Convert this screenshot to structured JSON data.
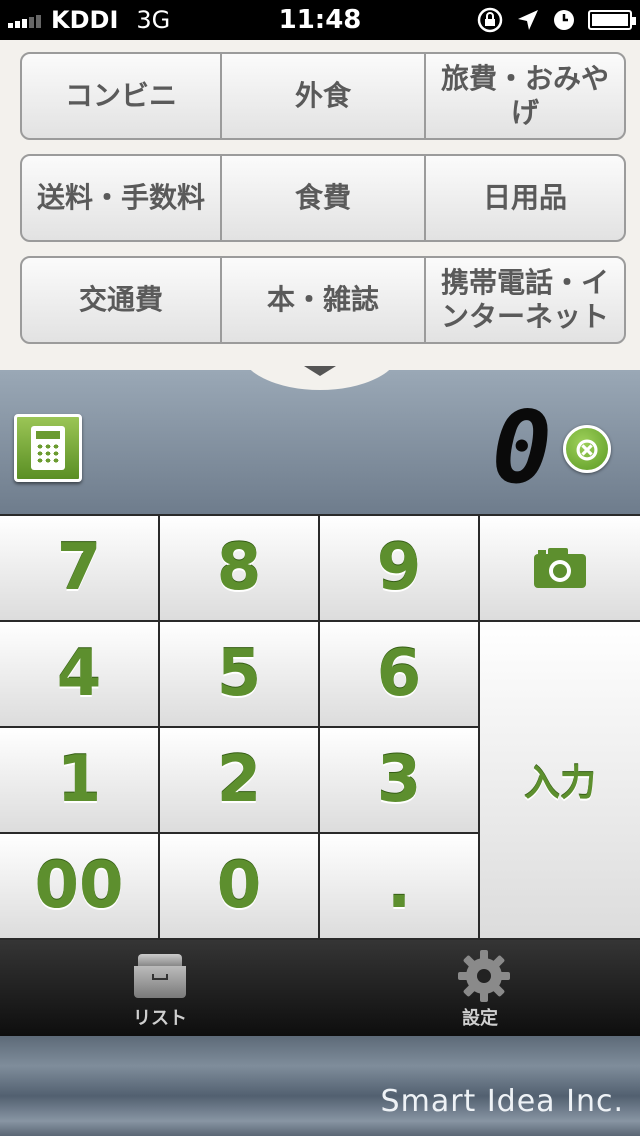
{
  "status_bar": {
    "carrier": "KDDI",
    "network": "3G",
    "time": "11:48",
    "icons": [
      "rotation-lock-icon",
      "location-icon",
      "alarm-icon",
      "battery-icon"
    ]
  },
  "categories": [
    [
      "コンビニ",
      "外食",
      "旅費・おみやげ"
    ],
    [
      "送料・手数料",
      "食費",
      "日用品"
    ],
    [
      "交通費",
      "本・雑誌",
      "携帯電話・インターネット"
    ]
  ],
  "display": {
    "amount": "0",
    "clear_label": "⊗",
    "calculator_icon": "calculator-icon"
  },
  "keypad": {
    "k7": "7",
    "k8": "8",
    "k9": "9",
    "k4": "4",
    "k5": "5",
    "k6": "6",
    "k1": "1",
    "k2": "2",
    "k3": "3",
    "k00": "00",
    "k0": "0",
    "kdot": ".",
    "enter": "入力",
    "camera_icon": "camera-icon"
  },
  "tabbar": {
    "list_label": "リスト",
    "settings_label": "設定"
  },
  "footer": {
    "text": "Smart Idea Inc."
  },
  "colors": {
    "accent_green": "#5d8f2e",
    "panel_bg": "#f3f1ed",
    "display_bg": "#8190a0"
  }
}
